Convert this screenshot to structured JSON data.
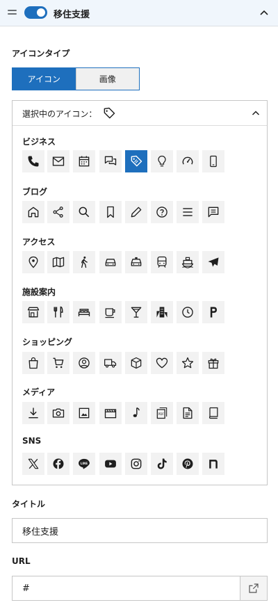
{
  "header": {
    "title": "移住支援",
    "toggle_on": true
  },
  "icon_type": {
    "label": "アイコンタイプ",
    "options": [
      "アイコン",
      "画像"
    ],
    "selected": "アイコン"
  },
  "picker": {
    "selected_label": "選択中のアイコン：",
    "selected_icon": "tag-icon",
    "categories": [
      {
        "label": "ビジネス",
        "icons": [
          "phone-icon",
          "mail-icon",
          "calendar-icon",
          "chat-icon",
          "tag-icon",
          "lightbulb-icon",
          "gauge-icon",
          "smartphone-icon"
        ],
        "selected_index": 4
      },
      {
        "label": "ブログ",
        "icons": [
          "home-icon",
          "share-icon",
          "search-icon",
          "bookmark-icon",
          "pencil-icon",
          "help-circle-icon",
          "menu-icon",
          "comment-icon"
        ]
      },
      {
        "label": "アクセス",
        "icons": [
          "map-pin-icon",
          "map-icon",
          "walking-icon",
          "car-icon",
          "taxi-icon",
          "train-icon",
          "ship-icon",
          "airplane-icon"
        ]
      },
      {
        "label": "施設案内",
        "icons": [
          "store-icon",
          "restaurant-icon",
          "bed-icon",
          "coffee-icon",
          "cocktail-icon",
          "building-icon",
          "clock-icon",
          "parking-icon"
        ]
      },
      {
        "label": "ショッピング",
        "icons": [
          "shopping-bag-icon",
          "cart-icon",
          "user-circle-icon",
          "truck-icon",
          "package-icon",
          "heart-icon",
          "star-icon",
          "gift-icon"
        ]
      },
      {
        "label": "メディア",
        "icons": [
          "download-icon",
          "camera-icon",
          "image-icon",
          "film-icon",
          "music-icon",
          "pdf-icon",
          "document-icon",
          "book-icon"
        ]
      },
      {
        "label": "SNS",
        "icons": [
          "x-icon",
          "facebook-icon",
          "line-icon",
          "youtube-icon",
          "instagram-icon",
          "tiktok-icon",
          "pinterest-icon",
          "note-icon"
        ]
      }
    ]
  },
  "title_field": {
    "label": "タイトル",
    "value": "移住支援"
  },
  "url_field": {
    "label": "URL",
    "value": "#"
  },
  "colors": {
    "accent": "#1e6fbd",
    "header_bg": "#f0f6fc",
    "cell_bg": "#f2f2f2"
  }
}
